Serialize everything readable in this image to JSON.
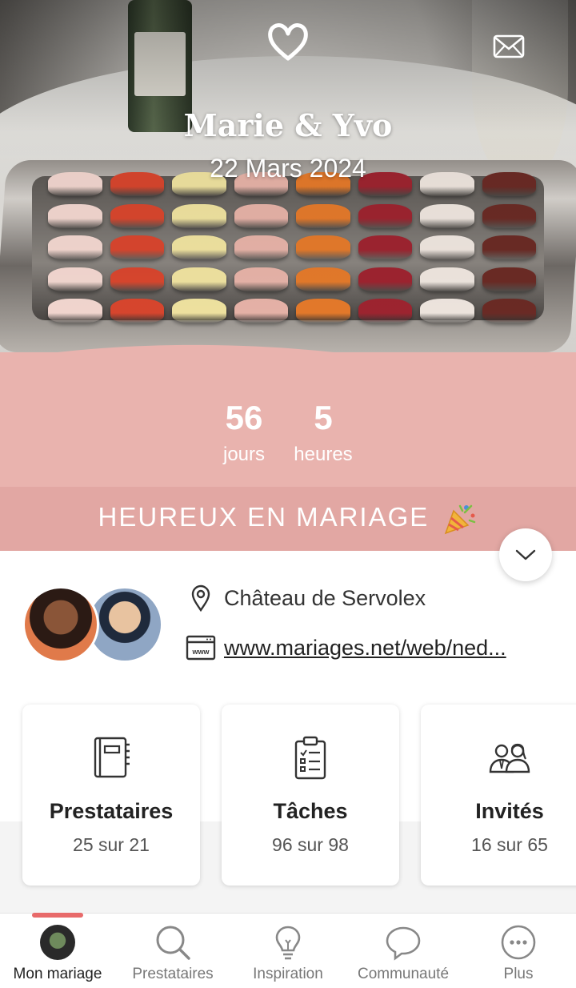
{
  "header": {
    "couple_names": "Marie & Yvo",
    "wedding_date": "22 Mars 2024",
    "logo_icon": "heart-icon",
    "messages_icon": "envelope-icon"
  },
  "countdown": {
    "days_value": "56",
    "days_label": "jours",
    "hours_value": "5",
    "hours_label": "heures"
  },
  "banner": {
    "text": "HEUREUX EN MARIAGE",
    "icon": "party-popper-icon"
  },
  "profile": {
    "venue": "Château de Servolex",
    "website": "www.mariages.net/web/ned..."
  },
  "cards": [
    {
      "title": "Prestataires",
      "count": "25 sur 21",
      "icon": "notebook-icon"
    },
    {
      "title": "Tâches",
      "count": "96 sur 98",
      "icon": "clipboard-checklist-icon"
    },
    {
      "title": "Invités",
      "count": "16 sur 65",
      "icon": "guests-icon"
    }
  ],
  "tabbar": {
    "items": [
      {
        "label": "Mon mariage",
        "icon": "profile-avatar",
        "active": true
      },
      {
        "label": "Prestataires",
        "icon": "search-icon"
      },
      {
        "label": "Inspiration",
        "icon": "lightbulb-icon"
      },
      {
        "label": "Communauté",
        "icon": "chat-bubble-icon"
      },
      {
        "label": "Plus",
        "icon": "more-icon"
      }
    ]
  },
  "colors": {
    "pink": "#e9b3ae",
    "banner_pink": "#e2a7a3",
    "accent": "#e86a6a"
  }
}
